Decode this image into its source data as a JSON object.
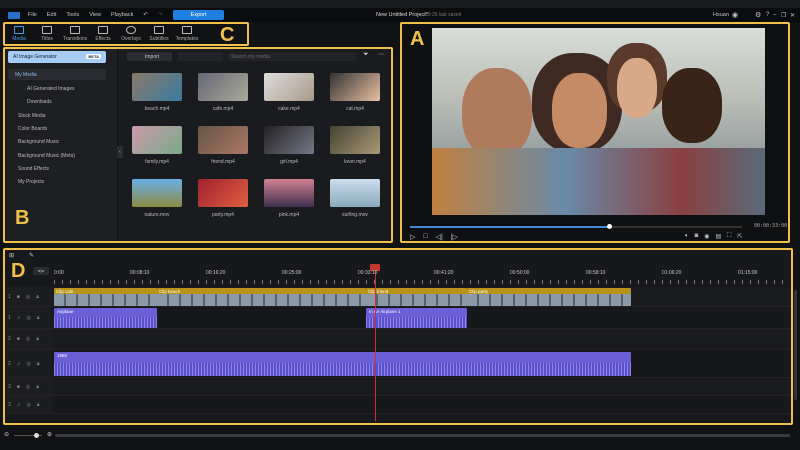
{
  "app": {
    "menus": [
      "File",
      "Edit",
      "Tools",
      "View",
      "Playback"
    ],
    "export_label": "Export",
    "project_title": "New Untitled Project*",
    "save_status": "09:26 last saved",
    "user": "Hsuan"
  },
  "toolbar": {
    "tabs": [
      {
        "label": "Media",
        "icon": "media-icon"
      },
      {
        "label": "Titles",
        "icon": "titles-icon"
      },
      {
        "label": "Transitions",
        "icon": "transitions-icon"
      },
      {
        "label": "Effects",
        "icon": "effects-icon"
      },
      {
        "label": "Overlays",
        "icon": "overlays-icon"
      },
      {
        "label": "Subtitles",
        "icon": "subtitles-icon"
      },
      {
        "label": "Templates",
        "icon": "templates-icon"
      }
    ]
  },
  "annotations": {
    "a": "A",
    "b": "B",
    "c": "C",
    "d": "D"
  },
  "sidebar": {
    "ai_generator": "AI Image Generator",
    "beta": "BETA",
    "items": [
      "My Media",
      "AI Generated Images",
      "Downloads",
      "Stock Media",
      "Color Boards",
      "Background Music",
      "Background Music (Meta)",
      "Sound Effects",
      "My Projects"
    ]
  },
  "media": {
    "import_label": "Import",
    "search_placeholder": "Search my media",
    "files": [
      "beach.mp4",
      "cafe.mp4",
      "cake.mp4",
      "cat.mp4",
      "family.mp4",
      "friend.mp4",
      "girl.mp4",
      "lover.mp4",
      "nature.mov",
      "party.mp4",
      "pink.mp4",
      "surfing.mov"
    ]
  },
  "preview": {
    "timecode": "00:00:33:00",
    "progress": 0.6
  },
  "timeline": {
    "ticks": [
      "0:00",
      "00:08:10",
      "00:16:20",
      "00:25:00",
      "00:33:10",
      "00:41:20",
      "00:50:00",
      "00:58:10",
      "01:06:20",
      "01:15:00"
    ],
    "video_clips": [
      {
        "label": "Clip cafe"
      },
      {
        "label": "Clip beach"
      },
      {
        "label": "Clip friend"
      },
      {
        "label": "Clip party"
      }
    ],
    "audio_clips": [
      {
        "label": "Airplane"
      },
      {
        "label": "In Air Airplane 1"
      },
      {
        "label": "1960"
      }
    ],
    "track_numbers": [
      "1",
      "1",
      "2",
      "2",
      "3",
      "3"
    ]
  }
}
